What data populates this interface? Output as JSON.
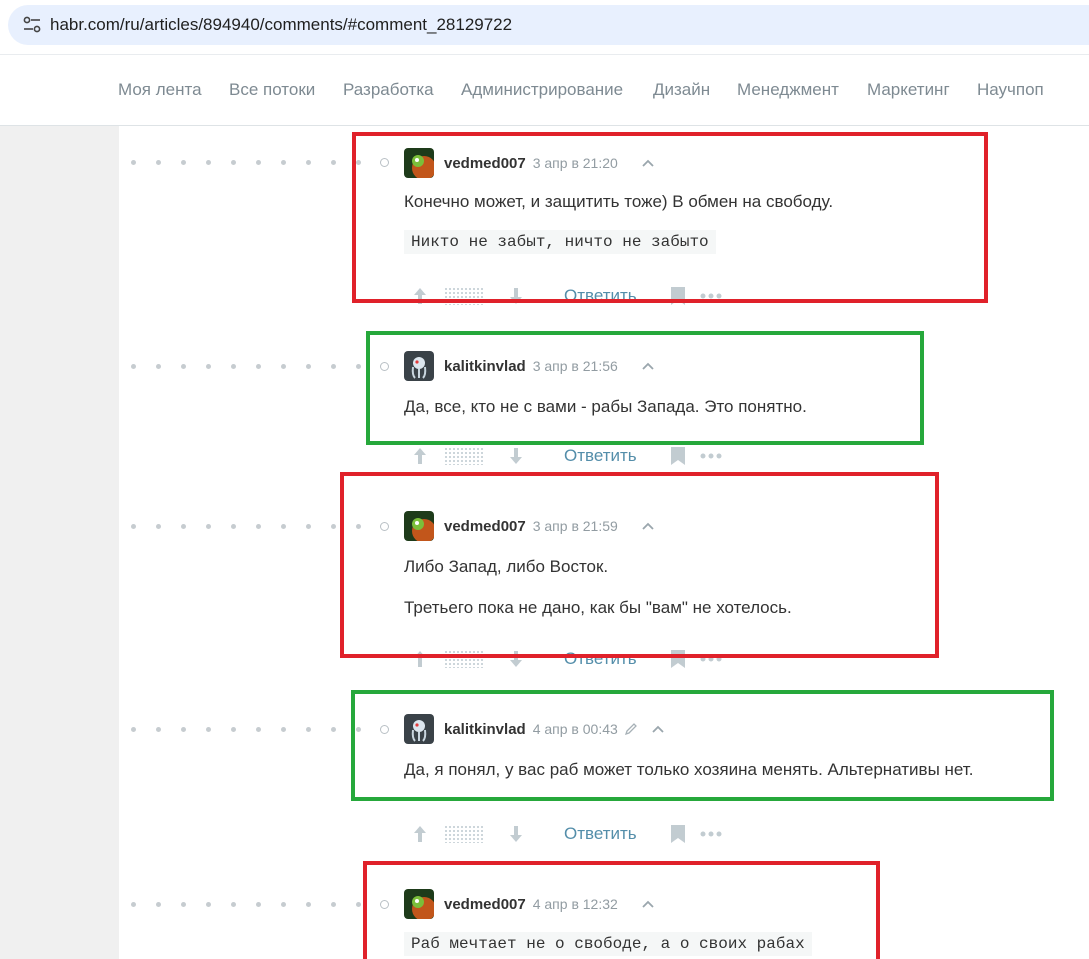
{
  "browser": {
    "url": "habr.com/ru/articles/894940/comments/#comment_28129722"
  },
  "nav": {
    "items": [
      "Моя лента",
      "Все потоки",
      "Разработка",
      "Администрирование",
      "Дизайн",
      "Менеджмент",
      "Маркетинг",
      "Научпоп"
    ]
  },
  "comments": [
    {
      "user": "vedmed007",
      "time": "3 апр в 21:20",
      "text": [
        "Конечно может, и защитить тоже) В обмен на свободу."
      ],
      "code": "Никто не забыт, ничто не забыто",
      "highlight": "red"
    },
    {
      "user": "kalitkinvlad",
      "time": "3 апр в 21:56",
      "text": [
        "Да, все, кто не с вами - рабы Запада. Это понятно."
      ],
      "highlight": "green"
    },
    {
      "user": "vedmed007",
      "time": "3 апр в 21:59",
      "text": [
        "Либо Запад, либо Восток.",
        "Третьего пока не дано, как бы \"вам\" не хотелось."
      ],
      "highlight": "red"
    },
    {
      "user": "kalitkinvlad",
      "time": "4 апр в 00:43",
      "edited": true,
      "text": [
        "Да, я понял, у вас раб может только хозяина менять. Альтернативы нет."
      ],
      "highlight": "green"
    },
    {
      "user": "vedmed007",
      "time": "4 апр в 12:32",
      "code": "Раб мечтает не о свободе, а о своих рабах",
      "highlight": "red"
    }
  ],
  "actions": {
    "reply_label": "Ответить"
  },
  "colors": {
    "highlight_red": "#e0212a",
    "highlight_green": "#26a83b",
    "link": "#548eaa"
  },
  "icons": [
    "site-settings-icon",
    "vote-up-icon",
    "vote-down-icon",
    "bookmark-icon",
    "more-icon",
    "collapse-chevron-icon",
    "edit-pencil-icon"
  ]
}
